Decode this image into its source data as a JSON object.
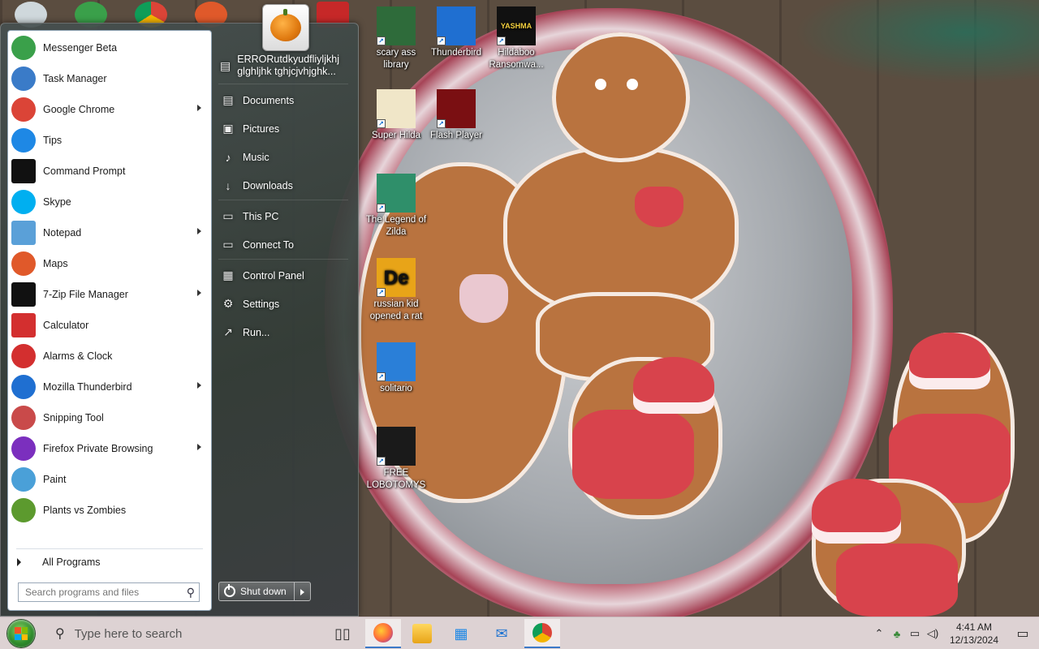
{
  "start_menu": {
    "programs": [
      {
        "label": "Messenger Beta",
        "icon": "messenger-icon",
        "color": "#3aa04a",
        "has_submenu": false
      },
      {
        "label": "Task Manager",
        "icon": "task-manager-icon",
        "color": "#3a7bc8",
        "has_submenu": false
      },
      {
        "label": "Google Chrome",
        "icon": "chrome-icon",
        "color": "#db4437",
        "has_submenu": true
      },
      {
        "label": "Tips",
        "icon": "tips-icon",
        "color": "#1e88e5",
        "has_submenu": false
      },
      {
        "label": "Command Prompt",
        "icon": "command-prompt-icon",
        "color": "#111111",
        "has_submenu": false
      },
      {
        "label": "Skype",
        "icon": "skype-icon",
        "color": "#00aff0",
        "has_submenu": false
      },
      {
        "label": "Notepad",
        "icon": "notepad-icon",
        "color": "#5aa0d8",
        "has_submenu": true
      },
      {
        "label": "Maps",
        "icon": "maps-icon",
        "color": "#e0592a",
        "has_submenu": false
      },
      {
        "label": "7-Zip File Manager",
        "icon": "7zip-icon",
        "color": "#111111",
        "has_submenu": true
      },
      {
        "label": "Calculator",
        "icon": "calculator-icon",
        "color": "#d32f2f",
        "has_submenu": false
      },
      {
        "label": "Alarms & Clock",
        "icon": "alarm-clock-icon",
        "color": "#d32f2f",
        "has_submenu": false
      },
      {
        "label": "Mozilla Thunderbird",
        "icon": "thunderbird-icon",
        "color": "#1f6fd1",
        "has_submenu": true
      },
      {
        "label": "Snipping Tool",
        "icon": "snipping-tool-icon",
        "color": "#c94a4a",
        "has_submenu": false
      },
      {
        "label": "Firefox Private Browsing",
        "icon": "firefox-private-icon",
        "color": "#7b2fbe",
        "has_submenu": true
      },
      {
        "label": "Paint",
        "icon": "paint-icon",
        "color": "#4aa0d8",
        "has_submenu": false
      },
      {
        "label": "Plants vs Zombies",
        "icon": "plants-vs-zombies-icon",
        "color": "#5c9a2e",
        "has_submenu": false
      }
    ],
    "all_programs_label": "All Programs",
    "search_placeholder": "Search programs and files",
    "right_items": [
      {
        "label": "ERRORutdkyudfliyljkhj glghljhk tghjcjvhjghk...",
        "icon": "user-folder-icon",
        "glyph": "▤",
        "tall": true
      },
      {
        "label": "Documents",
        "icon": "documents-icon",
        "glyph": "▤"
      },
      {
        "label": "Pictures",
        "icon": "pictures-icon",
        "glyph": "▣"
      },
      {
        "label": "Music",
        "icon": "music-icon",
        "glyph": "♪"
      },
      {
        "label": "Downloads",
        "icon": "downloads-icon",
        "glyph": "↓"
      },
      {
        "label": "This PC",
        "icon": "this-pc-icon",
        "glyph": "▭"
      },
      {
        "label": "Connect To",
        "icon": "connect-to-icon",
        "glyph": "▭"
      },
      {
        "label": "Control Panel",
        "icon": "control-panel-icon",
        "glyph": "▦"
      },
      {
        "label": "Settings",
        "icon": "settings-icon",
        "glyph": "⚙"
      },
      {
        "label": "Run...",
        "icon": "run-icon",
        "glyph": "↗"
      }
    ],
    "shutdown_label": "Shut down"
  },
  "desktop_icons": [
    {
      "label": "scary ass library",
      "icon": "library-icon",
      "color": "#2e6b3a"
    },
    {
      "label": "Thunderbird",
      "icon": "thunderbird-desktop-icon",
      "color": "#1f6fd1"
    },
    {
      "label": "Hildaboo Ransomwa...",
      "icon": "yashma-ransomware-icon",
      "color": "#111111",
      "badge": "YASHMA"
    },
    {
      "label": "Super Hilda",
      "icon": "super-hilda-icon",
      "color": "#f0e6c8"
    },
    {
      "label": "Flash Player",
      "icon": "flash-player-icon",
      "color": "#7a0f12"
    },
    {
      "label": "The Legend of Zilda",
      "icon": "legend-of-zilda-icon",
      "color": "#2f8f6a"
    },
    {
      "label": "russian kid opened a rat",
      "icon": "russian-kid-rat-icon",
      "color": "#e8a418",
      "badge": "De"
    },
    {
      "label": "solitario",
      "icon": "solitario-icon",
      "color": "#2a7fd8"
    },
    {
      "label": "FREE LOBOTOMYS",
      "icon": "free-lobotomys-icon",
      "color": "#1a1a1a"
    }
  ],
  "taskbar": {
    "search_placeholder": "Type here to search",
    "pinned": [
      {
        "name": "task-view-button",
        "icon": "task-view-icon",
        "active": false
      },
      {
        "name": "firefox-taskbar-button",
        "icon": "firefox-icon",
        "active": true
      },
      {
        "name": "file-explorer-taskbar-button",
        "icon": "file-explorer-icon",
        "active": false
      },
      {
        "name": "microsoft-store-taskbar-button",
        "icon": "store-icon",
        "active": false
      },
      {
        "name": "mail-taskbar-button",
        "icon": "mail-icon",
        "active": false
      },
      {
        "name": "chrome-taskbar-button",
        "icon": "chrome-icon",
        "active": true
      }
    ],
    "clock_time": "4:41 AM",
    "clock_date": "12/13/2024"
  }
}
